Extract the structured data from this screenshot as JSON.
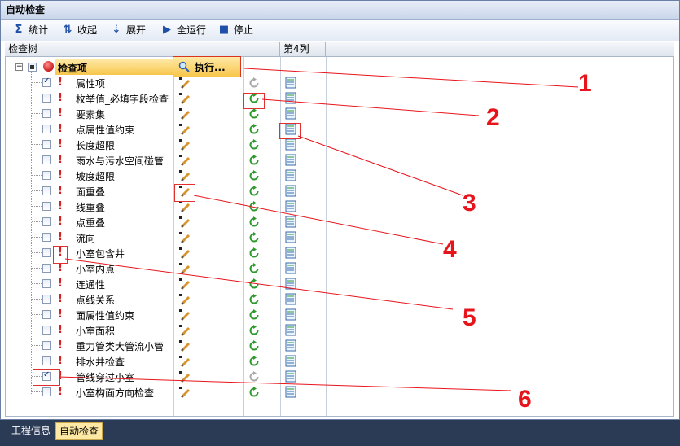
{
  "window": {
    "title": "自动检查"
  },
  "toolbar": {
    "stats": {
      "label": "统计",
      "icon": "sigma-icon"
    },
    "collapse": {
      "label": "收起",
      "icon": "collapse-icon"
    },
    "expand": {
      "label": "展开",
      "icon": "expand-icon"
    },
    "run_all": {
      "label": "全运行",
      "icon": "play-icon"
    },
    "stop": {
      "label": "停止",
      "icon": "stop-icon"
    }
  },
  "columns": {
    "tree": "检查树",
    "col2": "",
    "col3": "",
    "col4": "第4列"
  },
  "root": {
    "label": "检查项",
    "execute_label": "执行..."
  },
  "items": [
    {
      "label": "属性项",
      "checked": true,
      "refresh_active": false
    },
    {
      "label": "枚举值_必填字段检查",
      "checked": false,
      "refresh_active": true
    },
    {
      "label": "要素集",
      "checked": false,
      "refresh_active": true
    },
    {
      "label": "点属性值约束",
      "checked": false,
      "refresh_active": true
    },
    {
      "label": "长度超限",
      "checked": false,
      "refresh_active": true
    },
    {
      "label": "雨水与污水空间碰管",
      "checked": false,
      "refresh_active": true
    },
    {
      "label": "坡度超限",
      "checked": false,
      "refresh_active": true
    },
    {
      "label": "面重叠",
      "checked": false,
      "refresh_active": true
    },
    {
      "label": "线重叠",
      "checked": false,
      "refresh_active": true
    },
    {
      "label": "点重叠",
      "checked": false,
      "refresh_active": true
    },
    {
      "label": "流向",
      "checked": false,
      "refresh_active": true
    },
    {
      "label": "小室包含井",
      "checked": false,
      "refresh_active": true
    },
    {
      "label": "小室内点",
      "checked": false,
      "refresh_active": true
    },
    {
      "label": "连通性",
      "checked": false,
      "refresh_active": true
    },
    {
      "label": "点线关系",
      "checked": false,
      "refresh_active": true
    },
    {
      "label": "面属性值约束",
      "checked": false,
      "refresh_active": true
    },
    {
      "label": "小室面积",
      "checked": false,
      "refresh_active": true
    },
    {
      "label": "重力管类大管流小管",
      "checked": false,
      "refresh_active": true
    },
    {
      "label": "排水井检查",
      "checked": false,
      "refresh_active": true
    },
    {
      "label": "管线穿过小室",
      "checked": true,
      "refresh_active": false
    },
    {
      "label": "小室构面方向检查",
      "checked": false,
      "refresh_active": true
    }
  ],
  "annotations": [
    "1",
    "2",
    "3",
    "4",
    "5",
    "6"
  ],
  "bottom_tabs": [
    {
      "label": "工程信息",
      "active": false
    },
    {
      "label": "自动检查",
      "active": true
    }
  ],
  "colors": {
    "accent_red": "#e8141b",
    "highlight": "#f7c64b",
    "refresh_green": "#2e9a2e"
  }
}
